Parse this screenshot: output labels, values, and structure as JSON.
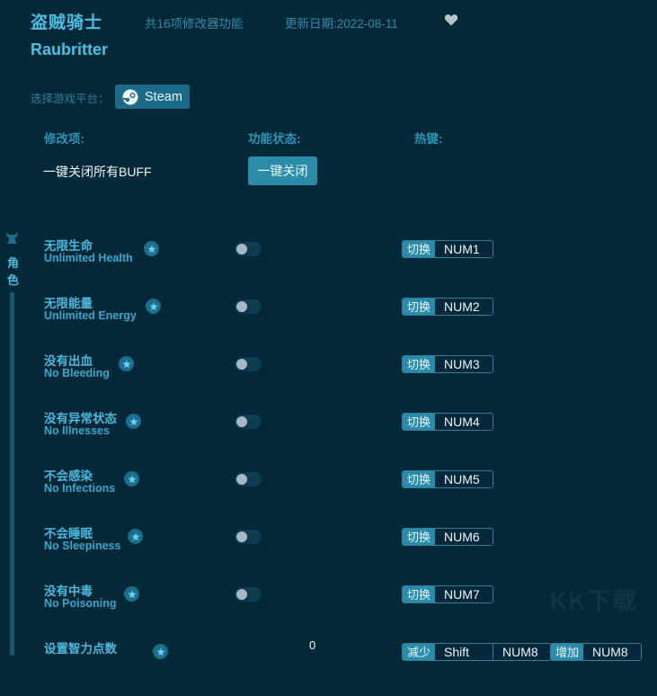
{
  "header": {
    "title_cn": "盗贼骑士",
    "feature_count": "共16项修改器功能",
    "update_date": "更新日期:2022-08-11",
    "favorite_icon": "heart-icon",
    "title_en": "Raubritter"
  },
  "platform": {
    "label": "选择游戏平台：",
    "selected": "Steam",
    "icon": "steam-icon"
  },
  "columns": {
    "item": "修改项:",
    "status": "功能状态:",
    "hotkey": "热键:"
  },
  "buff": {
    "label": "一键关闭所有BUFF",
    "button": "一键关闭"
  },
  "sidebar": {
    "category": "角色",
    "icon": "character-icon"
  },
  "cheats": [
    {
      "cn": "无限生命",
      "en": "Unlimited Health",
      "enabled": false,
      "action": "切换",
      "key": "NUM1"
    },
    {
      "cn": "无限能量",
      "en": "Unlimited Energy",
      "enabled": false,
      "action": "切换",
      "key": "NUM2"
    },
    {
      "cn": "没有出血",
      "en": "No Bleeding",
      "enabled": false,
      "action": "切换",
      "key": "NUM3"
    },
    {
      "cn": "没有异常状态",
      "en": "No Illnesses",
      "enabled": false,
      "action": "切换",
      "key": "NUM4"
    },
    {
      "cn": "不会感染",
      "en": "No Infections",
      "enabled": false,
      "action": "切换",
      "key": "NUM5"
    },
    {
      "cn": "不会睡眠",
      "en": "No Sleepiness",
      "enabled": false,
      "action": "切换",
      "key": "NUM6"
    },
    {
      "cn": "没有中毒",
      "en": "No Poisoning",
      "enabled": false,
      "action": "切换",
      "key": "NUM7"
    }
  ],
  "numeric_cheat": {
    "cn": "设置智力点数",
    "value": "0",
    "decrease": {
      "action": "减少",
      "keys": [
        "Shift",
        "NUM8"
      ]
    },
    "increase": {
      "action": "增加",
      "keys": [
        "NUM8"
      ]
    }
  },
  "watermark": "KK下载"
}
